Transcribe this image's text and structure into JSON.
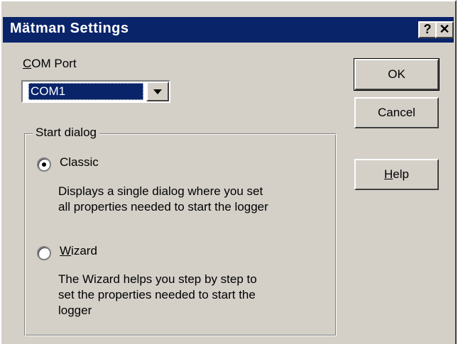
{
  "window": {
    "title": "Mätman Settings",
    "help_glyph": "?",
    "close_glyph": "✕"
  },
  "com_port": {
    "label": "COM Port",
    "selected": "COM1"
  },
  "start_dialog": {
    "group_label": "Start dialog",
    "options": [
      {
        "label": "Classic",
        "checked": true,
        "description_lines": [
          "Displays a single dialog where you set",
          "all properties needed to start the logger"
        ]
      },
      {
        "label": "Wizard",
        "checked": false,
        "description_lines": [
          "The Wizard helps you step by step to",
          "set the properties needed to start the",
          "logger"
        ]
      }
    ]
  },
  "buttons": {
    "ok": "OK",
    "cancel": "Cancel",
    "help": "Help"
  },
  "colors": {
    "titlebar": "#0a246a",
    "face": "#d4d0c8",
    "selection": "#0a246a"
  }
}
